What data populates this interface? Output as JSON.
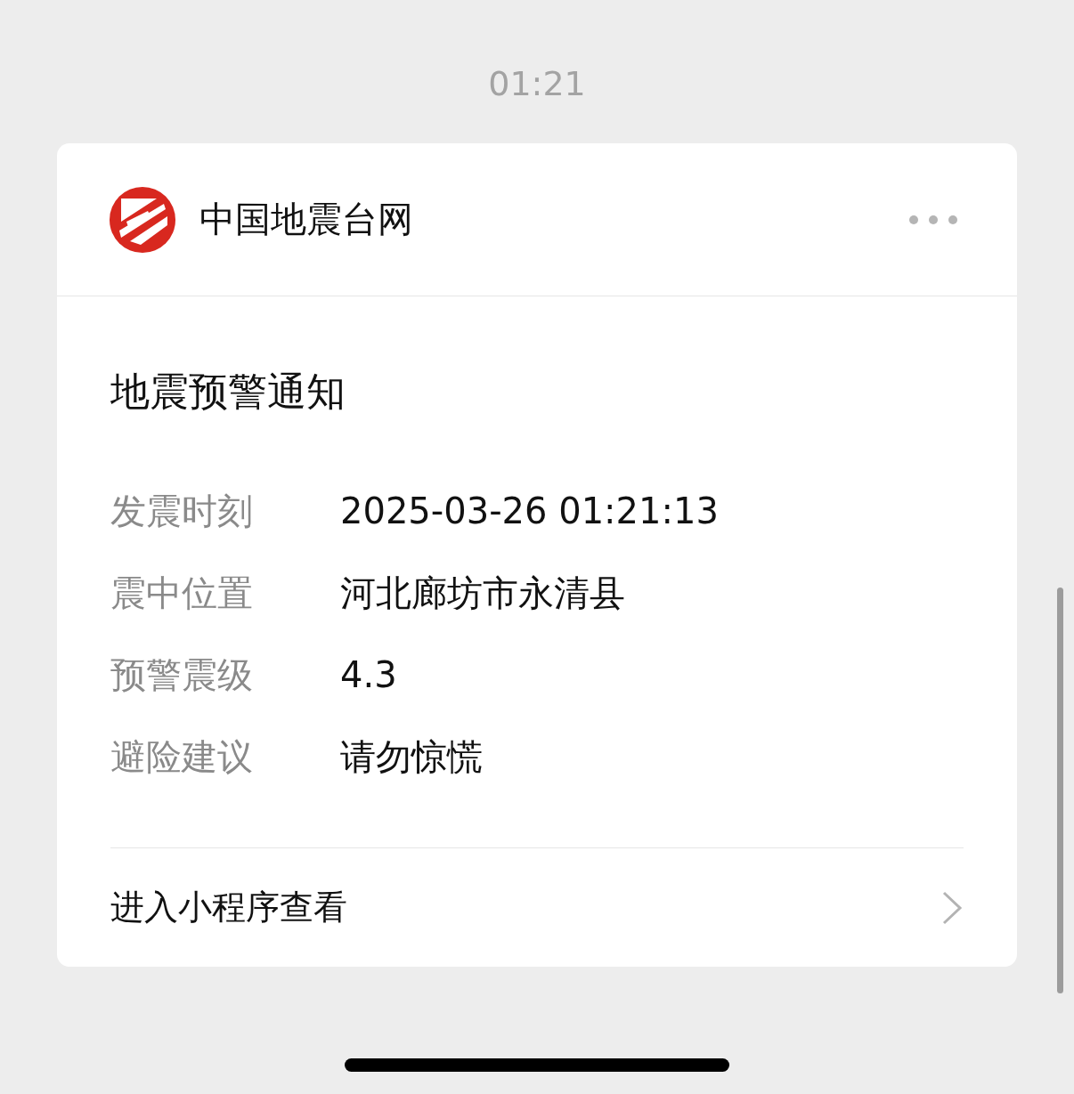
{
  "time": "01:21",
  "card": {
    "account": "中国地震台网",
    "title": "地震预警通知",
    "fields": [
      {
        "label": "发震时刻",
        "value": "2025-03-26 01:21:13"
      },
      {
        "label": "震中位置",
        "value": "河北廊坊市永清县"
      },
      {
        "label": "预警震级",
        "value": "4.3"
      },
      {
        "label": "避险建议",
        "value": "请勿惊慌"
      }
    ],
    "link": "进入小程序查看"
  }
}
